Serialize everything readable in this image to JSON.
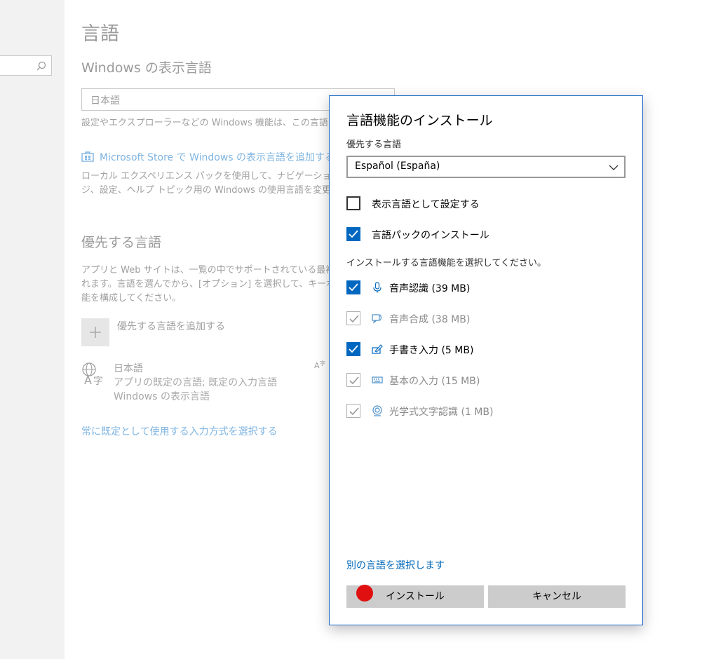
{
  "background": {
    "page_title": "言語",
    "display_language_heading": "Windows の表示言語",
    "display_language_value": "日本語",
    "display_language_desc": "設定やエクスプローラーなどの Windows 機能は、この言語で表",
    "store_link": "Microsoft Store で Windows の表示言語を追加する",
    "lxp_desc_line1": "ローカル エクスペリエンス パックを使用して、ナビゲーション、メニ",
    "lxp_desc_line2": "ジ、設定、ヘルプ トピック用の Windows の使用言語を変更します",
    "preferred_heading": "優先する言語",
    "preferred_desc_line1": "アプリと Web サイトは、一覧の中でサポートされている最初の言",
    "preferred_desc_line2": "れます。言語を選んでから、[オプション] を選択して、キーボード",
    "preferred_desc_line3": "能を構成してください。",
    "add_language_label": "優先する言語を追加する",
    "language_item": {
      "name": "日本語",
      "sub1": "アプリの既定の言語; 既定の入力言語",
      "sub2": "Windows の表示言語"
    },
    "default_input_link": "常に既定として使用する入力方式を選択する"
  },
  "dialog": {
    "title": "言語機能のインストール",
    "preferred_label": "優先する言語",
    "selected_language": "Español (España)",
    "set_display_label": "表示言語として設定する",
    "set_display_checked": false,
    "install_pack_label": "言語パックのインストール",
    "install_pack_checked": true,
    "features_hint": "インストールする言語機能を選択してください。",
    "features": [
      {
        "label": "音声認識 (39 MB)",
        "checked": true,
        "disabled": false,
        "icon": "microphone-icon"
      },
      {
        "label": "音声合成 (38 MB)",
        "checked": true,
        "disabled": true,
        "icon": "speech-synthesis-icon"
      },
      {
        "label": "手書き入力 (5 MB)",
        "checked": true,
        "disabled": false,
        "icon": "handwriting-icon"
      },
      {
        "label": "基本の入力 (15 MB)",
        "checked": true,
        "disabled": true,
        "icon": "keyboard-icon"
      },
      {
        "label": "光学式文字認識 (1 MB)",
        "checked": true,
        "disabled": true,
        "icon": "ocr-icon"
      }
    ],
    "other_language_link": "別の言語を選択します",
    "install_button": "インストール",
    "cancel_button": "キャンセル"
  },
  "colors": {
    "accent": "#0067c0",
    "link": "#0067b8",
    "dialog_border": "#1b6ac9",
    "marker": "#e01010"
  }
}
